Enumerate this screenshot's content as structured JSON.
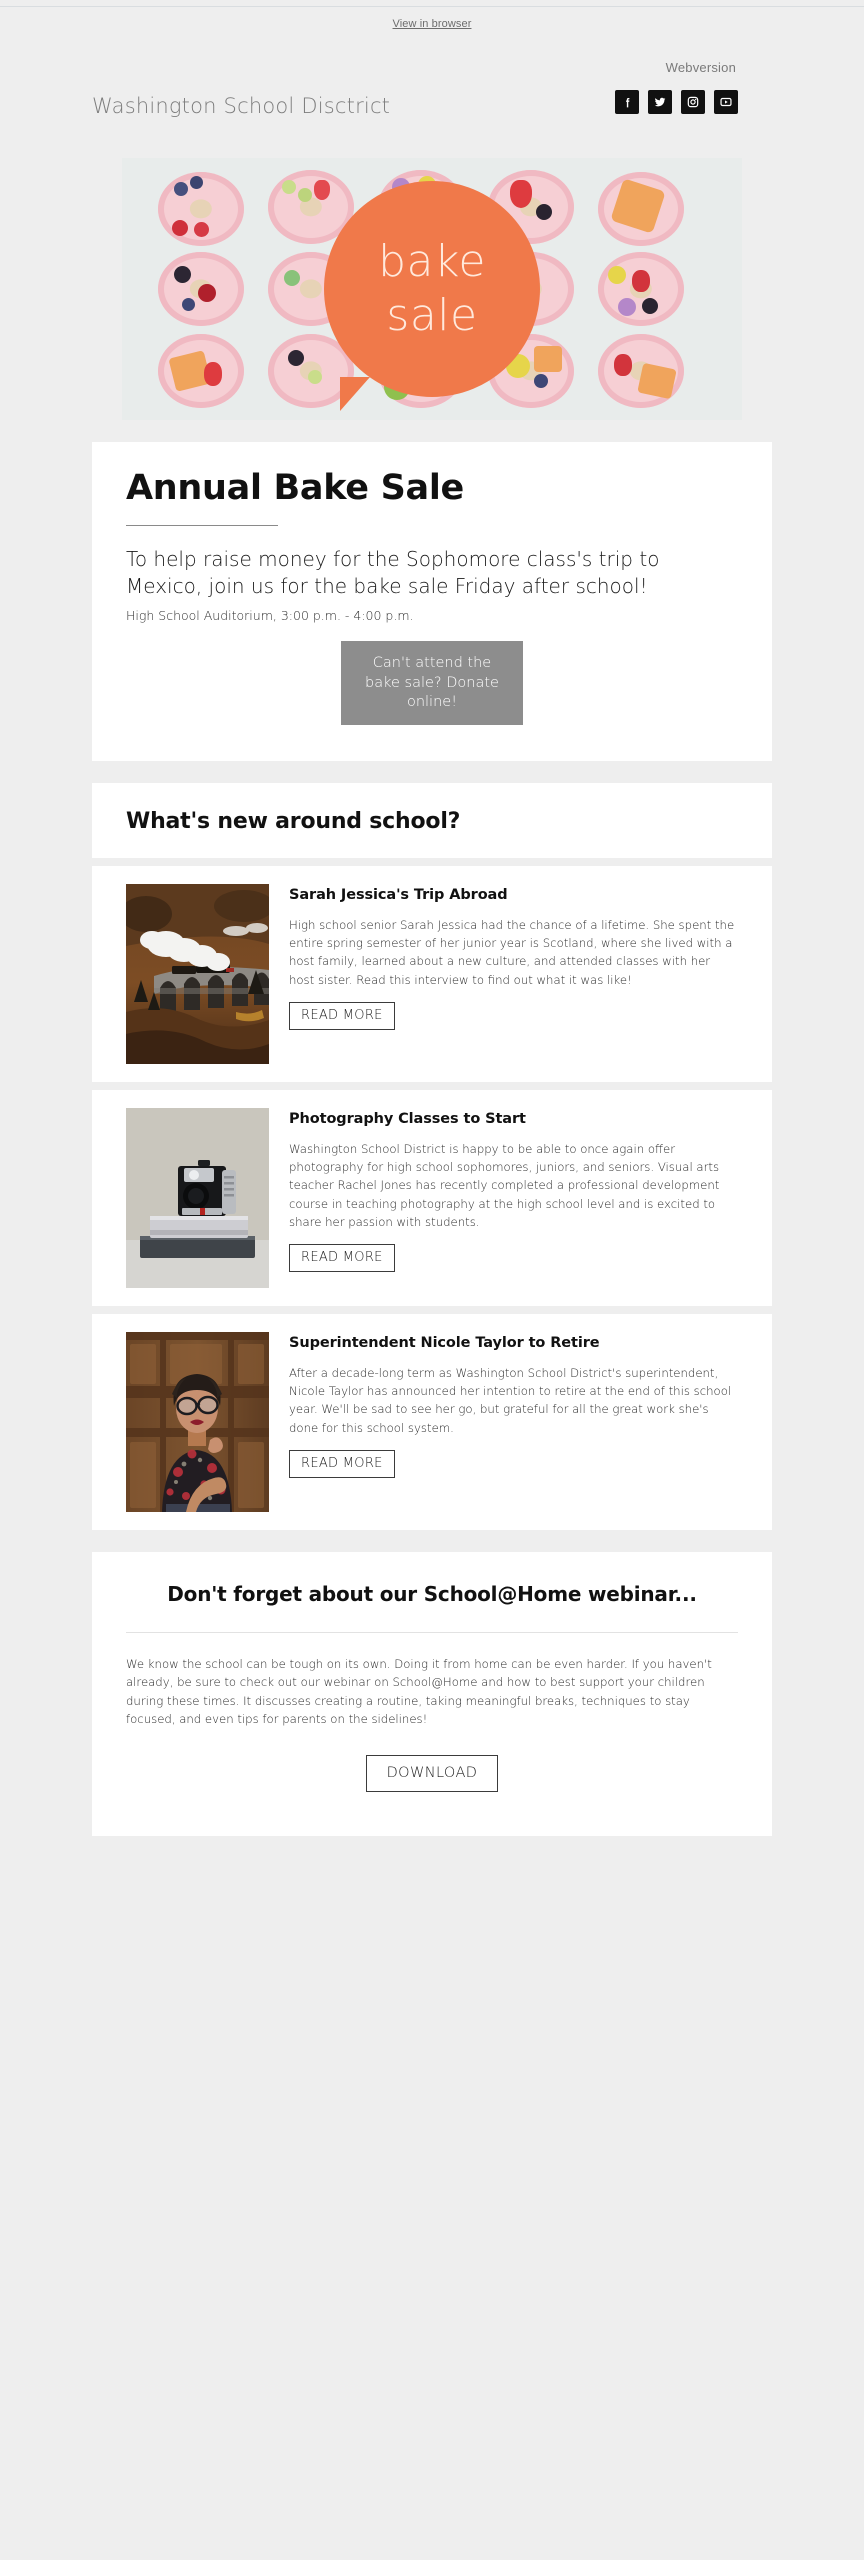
{
  "preheader": {
    "view_in_browser": "View in browser"
  },
  "header": {
    "webversion": "Webversion",
    "brand_title": "Washington School Disctrict",
    "social": [
      {
        "name": "facebook-icon",
        "label": "Facebook"
      },
      {
        "name": "twitter-icon",
        "label": "Twitter"
      },
      {
        "name": "instagram-icon",
        "label": "Instagram"
      },
      {
        "name": "youtube-icon",
        "label": "YouTube"
      }
    ]
  },
  "hero": {
    "bubble_line_1": "bake",
    "bubble_line_2": "sale",
    "bubble_color": "#f0794a",
    "alt": "fruit-topped cakes arranged in a grid"
  },
  "bake_sale": {
    "title": "Annual Bake Sale",
    "lede": "To help raise money for the Sophomore class's trip to Mexico, join us for the bake sale Friday after school!",
    "details": "High School Auditorium, 3:00 p.m. - 4:00 p.m.",
    "cta_label": "Can't attend the bake sale? Donate online!",
    "cta_color": "#8d8d8d"
  },
  "news": {
    "heading": "What's new around school?",
    "read_more_label": "READ MORE",
    "articles": [
      {
        "title": "Sarah Jessica's Trip Abroad",
        "body": "High school senior Sarah Jessica had the chance of a lifetime. She spent the entire spring semester of her junior year is Scotland, where she lived with a host family, learned about a new culture, and attended classes with her host sister. Read this interview to find out what it was like!",
        "image_alt": "steam train crossing a stone viaduct in autumn highlands",
        "cta": "READ MORE"
      },
      {
        "title": "Photography Classes to Start",
        "body": "Washington School District is happy to be able to once again offer photography for high school sophomores, juniors, and seniors. Visual arts teacher Rachel Jones has recently completed a professional development course in teaching photography at the high school level and is excited to share her passion with students.",
        "image_alt": "vintage box camera resting on a stack of books",
        "cta": "READ MORE"
      },
      {
        "title": "Superintendent Nicole Taylor to Retire",
        "body": "After a decade-long term as Washington School District's superintendent, Nicole Taylor has announced her intention to retire at the end of this school year. We'll be sad to see her go, but grateful for all the great work she's done for this school system.",
        "image_alt": "woman with glasses and floral blouse in front of wooden doors",
        "cta": "READ MORE"
      }
    ]
  },
  "webinar": {
    "heading": "Don't forget about our School@Home webinar...",
    "body": "We know the school can be tough on its own. Doing it from home can be even harder. If you haven't already, be sure to check out our webinar on School@Home and how to best support your children during these times. It discusses creating a routine, taking meaningful breaks, techniques to stay focused, and even tips for parents on the sidelines!",
    "cta_label": "DOWNLOAD"
  },
  "colors": {
    "page_background": "#eeeeee",
    "panel_background": "#ffffff",
    "accent": "#f0794a",
    "text": "#111111",
    "muted_text": "#7a7a7a"
  }
}
